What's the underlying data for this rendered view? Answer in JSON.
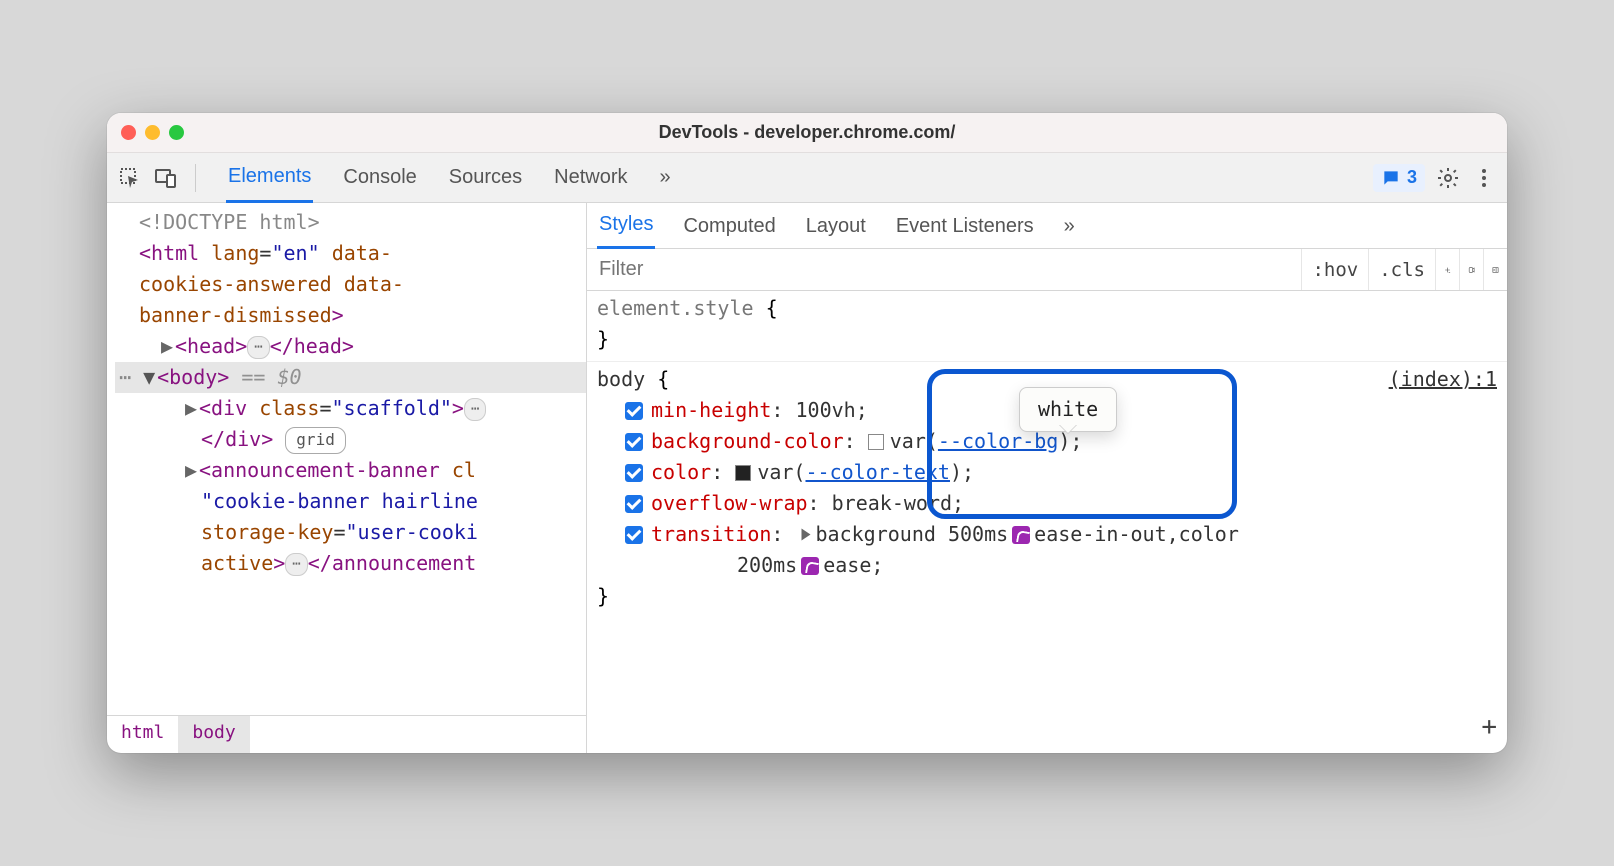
{
  "window_title": "DevTools - developer.chrome.com/",
  "main_tabs": [
    "Elements",
    "Console",
    "Sources",
    "Network"
  ],
  "main_tabs_overflow": "»",
  "badge_count": "3",
  "dom": {
    "doctype": "<!DOCTYPE html>",
    "html_open": "<html lang=\"en\" data-cookies-answered data-banner-dismissed>",
    "head": {
      "open": "<head>",
      "close": "</head>"
    },
    "body_open": "<body>",
    "body_selected_hint": "== $0",
    "scaffold_open": "<div class=\"scaffold\">",
    "scaffold_close": "</div>",
    "grid_badge": "grid",
    "announcement_open": "<announcement-banner class=\"cookie-banner hairline\" storage-key=\"user-cookie\" active>",
    "announcement_close": "</announcement-banner>"
  },
  "crumbs": [
    "html",
    "body"
  ],
  "sub_tabs": [
    "Styles",
    "Computed",
    "Layout",
    "Event Listeners"
  ],
  "filter_placeholder": "Filter",
  "filter_buttons": {
    "hov": ":hov",
    "cls": ".cls"
  },
  "rules": {
    "element_style": {
      "selector": "element.style",
      "open": "{",
      "close": "}"
    },
    "body": {
      "selector": "body",
      "open": "{",
      "close": "}",
      "source": "(index):1",
      "decls": [
        {
          "prop": "min-height",
          "val": "100vh;"
        },
        {
          "prop": "background-color",
          "val_prefix": "var(",
          "var": "--color-bg",
          "val_suffix": ");"
        },
        {
          "prop": "color",
          "val_prefix": "var(",
          "var": "--color-text",
          "val_suffix": ");"
        },
        {
          "prop": "overflow-wrap",
          "val": "break-word;"
        },
        {
          "prop": "transition",
          "bg": "background 500ms",
          "ease1": "ease-in-out",
          "comma": ",color",
          "dur2": "200ms",
          "ease2": "ease;"
        }
      ]
    }
  },
  "tooltip": "white"
}
